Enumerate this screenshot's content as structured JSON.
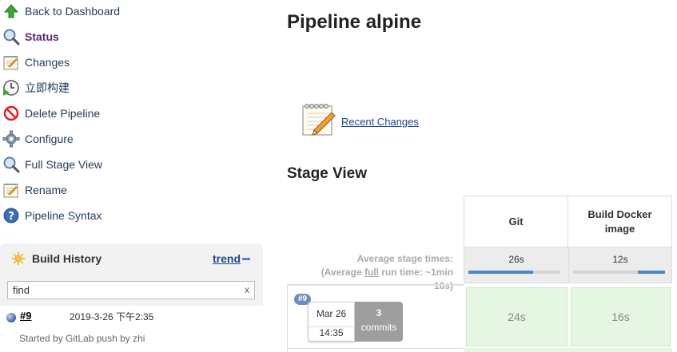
{
  "sidebar": {
    "tasks": [
      {
        "label": "Back to Dashboard",
        "icon": "up-arrow-icon"
      },
      {
        "label": "Status",
        "icon": "magnifier-icon"
      },
      {
        "label": "Changes",
        "icon": "notepad-icon"
      },
      {
        "label": "立即构建",
        "icon": "clock-play-icon"
      },
      {
        "label": "Delete Pipeline",
        "icon": "no-entry-icon"
      },
      {
        "label": "Configure",
        "icon": "gear-icon"
      },
      {
        "label": "Full Stage View",
        "icon": "magnifier-icon"
      },
      {
        "label": "Rename",
        "icon": "notepad-icon"
      },
      {
        "label": "Pipeline Syntax",
        "icon": "help-icon"
      }
    ],
    "active_task": "Status"
  },
  "build_history": {
    "title": "Build History",
    "trend_label": "trend",
    "search_value": "find",
    "clear_label": "x",
    "builds": [
      {
        "number": "#9",
        "date": "2019-3-26 下午2:35",
        "note": "Started by GitLab push by zhi"
      }
    ]
  },
  "main": {
    "title": "Pipeline alpine",
    "recent_changes_label": "Recent Changes",
    "stage_view_title": "Stage View"
  },
  "stage_view": {
    "stages": [
      "Git",
      "Build Docker image"
    ],
    "average_label_prefix": "Average stage times:",
    "average_label_open": "(Average ",
    "average_label_full": "full",
    "average_label_rest": " run time: ~1min",
    "average_label_end": "16s)",
    "average_times": [
      "26s",
      "12s"
    ],
    "average_bar_fractions": [
      0.7,
      0.3
    ],
    "run": {
      "badge": "#9",
      "date": "Mar 26",
      "time": "14:35",
      "commits_count": "3",
      "commits_label": "commits",
      "stage_times": [
        "24s",
        "16s"
      ]
    }
  },
  "colors": {
    "link": "#204a87",
    "success_cell": "#e5f7e2",
    "progress_bar": "#4d87c7"
  }
}
